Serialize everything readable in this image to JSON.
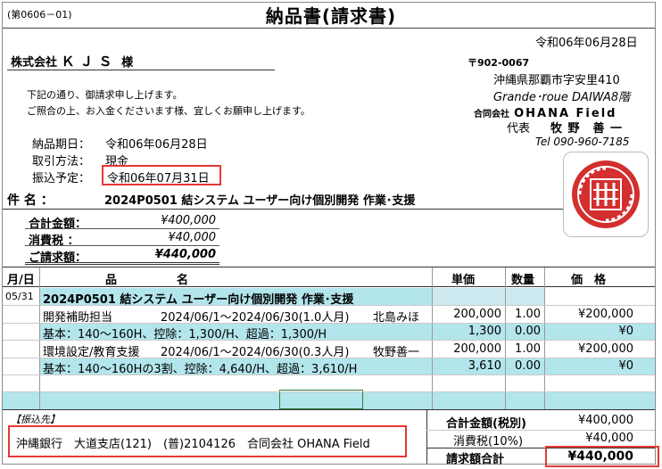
{
  "doc": {
    "code": "(第0606－01)",
    "title": "納品書(請求書)",
    "date": "令和06年06月28日"
  },
  "client": {
    "prefix": "株式会社",
    "name": "ＫＪＳ",
    "suffix": "様"
  },
  "message": {
    "line1": "下記の通り、御請求申し上げます。",
    "line2": "ご照合の上、お入金くださいます様、宜しくお願申し上げます。"
  },
  "info": [
    {
      "label": "納品期日：",
      "value": "令和06年06月28日"
    },
    {
      "label": "取引方法：",
      "value": "現金"
    },
    {
      "label": "振込予定：",
      "value": "令和06年07月31日"
    }
  ],
  "sender": {
    "zip": "〒902-0067",
    "address1": "沖縄県那覇市字安里410",
    "address2": "Grande･roue DAIWA8階",
    "company_prefix": "合同会社",
    "company": "OHANA Field",
    "rep_title": "代表",
    "rep_name": "牧 野　善 一",
    "tel": "Tel 090-960-7185",
    "seal_text": "合同会社 OHANA Field 代表印"
  },
  "subject": {
    "label": "件 名 ：",
    "value": "2024P0501 結システム ユーザー向け個別開発 作業･支援"
  },
  "summary": [
    {
      "label": "合計金額：",
      "value": "¥400,000"
    },
    {
      "label": "消費税 ：",
      "value": "¥40,000"
    },
    {
      "label": "ご請求額：",
      "value": "¥440,000"
    }
  ],
  "table": {
    "headers": {
      "date": "月/日",
      "item1": "品",
      "item2": "名",
      "unit": "単価",
      "qty": "数量",
      "price": "価　格"
    },
    "group_date": "05/31",
    "group_title": "2024P0501 結システム ユーザー向け個別開発 作業･支援",
    "rows": [
      {
        "name": "開発補助担当",
        "period": "2024/06/1～2024/06/30(1.0人月)",
        "person": "北島みほ",
        "unit": "200,000",
        "qty": "1.00",
        "price": "¥200,000"
      },
      {
        "name": "基本：140～160H、控除：1,300/H、超過：1,300/H",
        "period": "",
        "person": "",
        "unit": "1,300",
        "qty": "0.00",
        "price": "¥0"
      },
      {
        "name": "環境設定/教育支援",
        "period": "2024/06/1～2024/06/30(0.3人月)",
        "person": "牧野善一",
        "unit": "200,000",
        "qty": "1.00",
        "price": "¥200,000"
      },
      {
        "name": "基本：140～160Hの3割、控除：4,640/H、超過：3,610/H",
        "period": "",
        "person": "",
        "unit": "3,610",
        "qty": "0.00",
        "price": "¥0"
      }
    ]
  },
  "bank": {
    "label": "【振込先】",
    "value": "沖縄銀行　大道支店(121)　(普)2104126　合同会社 OHANA Field"
  },
  "totals": [
    {
      "label": "合計金額(税別)",
      "value": "¥400,000"
    },
    {
      "label": "消費税(10%)",
      "value": "¥40,000"
    },
    {
      "label": "請求額合計",
      "value": "¥440,000"
    }
  ],
  "colors": {
    "highlight": "#e53935",
    "band": "#b3e5ec"
  }
}
